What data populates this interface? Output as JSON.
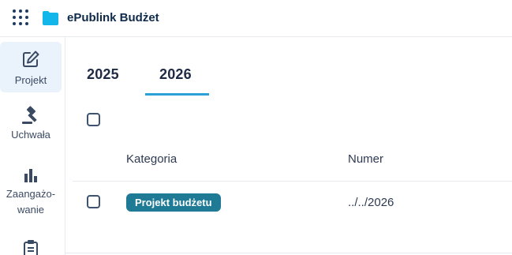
{
  "app": {
    "title": "ePublink Budżet"
  },
  "header": {
    "apps_icon": "grid-dots-icon",
    "logo_icon": "folder-icon",
    "brand_color": "#13b6e8"
  },
  "sidebar": {
    "items": [
      {
        "label": "Projekt",
        "icon": "edit-icon",
        "active": true
      },
      {
        "label": "Uchwała",
        "icon": "gavel-icon"
      },
      {
        "label_line1": "Zaangażo-",
        "label_line2": "wanie",
        "icon": "bar-chart-icon"
      },
      {
        "icon": "clipboard-icon"
      }
    ]
  },
  "tabs": [
    {
      "label": "2025"
    },
    {
      "label": "2026",
      "active": true
    }
  ],
  "table": {
    "columns": [
      "Kategoria",
      "Numer"
    ],
    "rows": [
      {
        "kategoria": "Projekt budżetu",
        "numer": "../../2026"
      }
    ]
  },
  "colors": {
    "accent": "#2aa0d4",
    "badge": "#1e7a95",
    "active_bg": "#eaf2fb"
  }
}
